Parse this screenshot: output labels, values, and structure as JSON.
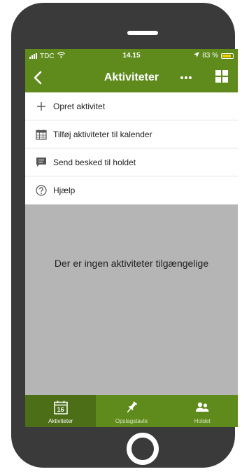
{
  "status": {
    "carrier": "TDC",
    "time": "14.15",
    "battery": "83 %"
  },
  "nav": {
    "title": "Aktiviteter"
  },
  "menu": [
    {
      "label": "Opret aktivitet",
      "icon": "plus-icon"
    },
    {
      "label": "Tilføj aktiviteter til kalender",
      "icon": "calendar-grid-icon"
    },
    {
      "label": "Send besked til holdet",
      "icon": "message-icon"
    },
    {
      "label": "Hjælp",
      "icon": "help-icon"
    }
  ],
  "empty_message": "Der er ingen aktiviteter tilgængelige",
  "tabs": [
    {
      "label": "Aktiviteter",
      "icon": "calendar-icon",
      "badge": "16",
      "active": true
    },
    {
      "label": "Opslagstavle",
      "icon": "pin-icon",
      "active": false
    },
    {
      "label": "Holdet",
      "icon": "team-icon",
      "active": false
    }
  ],
  "colors": {
    "brand_green": "#5f8a1c",
    "active_tab": "#4b6e17",
    "empty_gray": "#b5b5b5",
    "battery_yellow": "#f5d000"
  }
}
